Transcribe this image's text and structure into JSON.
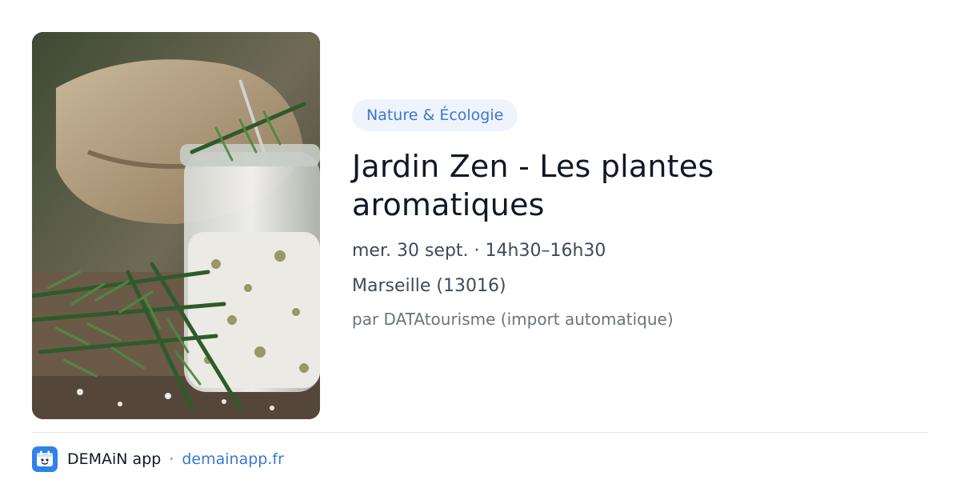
{
  "event": {
    "category": "Nature & Écologie",
    "title": "Jardin Zen - Les plantes aromatiques",
    "datetime": "mer. 30 sept. · 14h30–16h30",
    "location": "Marseille (13016)",
    "source": "par DATAtourisme (import automatique)",
    "image": "photo-rosemary-salt-jar"
  },
  "footer": {
    "app_name": "DEMAiN app",
    "separator": "·",
    "domain": "demainapp.fr",
    "icon": "demain-app-logo-icon"
  },
  "colors": {
    "accent": "#3b77d3",
    "badge_bg": "#eef3fc",
    "title": "#101828",
    "text": "#3f4a5a",
    "muted": "#6b7280",
    "icon_bg": "#2f82e8"
  }
}
